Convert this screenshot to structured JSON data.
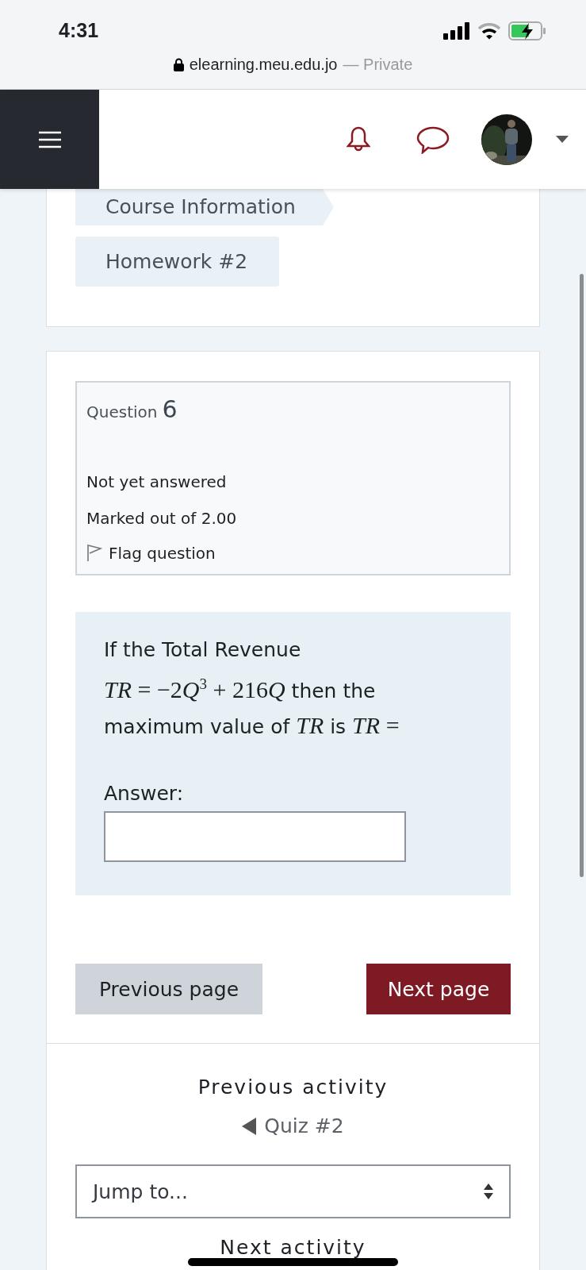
{
  "status_bar": {
    "time": "4:31"
  },
  "address_bar": {
    "url": "elearning.meu.edu.jo",
    "mode": "— Private"
  },
  "breadcrumb": [
    {
      "label": "Course Information",
      "kind": "chevron"
    },
    {
      "label": "Homework #2",
      "kind": "plain"
    }
  ],
  "question_info": {
    "label": "Question",
    "number": "6",
    "status": "Not yet answered",
    "marks": "Marked out of 2.00",
    "flag": "Flag question",
    "flagged": false
  },
  "question": {
    "segments": [
      {
        "kind": "text",
        "text": "If the Total Revenue"
      },
      {
        "kind": "math",
        "tokens": [
          {
            "kind": "var",
            "text": "TR"
          },
          {
            "kind": "op",
            "text": " = −2"
          },
          {
            "kind": "var",
            "text": "Q"
          },
          {
            "kind": "sup",
            "text": "3"
          },
          {
            "kind": "op",
            "text": " + 216"
          },
          {
            "kind": "var",
            "text": "Q"
          }
        ]
      },
      {
        "kind": "text",
        "text": "then the maximum value of"
      },
      {
        "kind": "math",
        "tokens": [
          {
            "kind": "var",
            "text": "TR"
          }
        ]
      },
      {
        "kind": "text",
        "text": "is"
      },
      {
        "kind": "math",
        "tokens": [
          {
            "kind": "var",
            "text": "TR"
          },
          {
            "kind": "op",
            "text": " ="
          }
        ]
      }
    ],
    "answer_label": "Answer:"
  },
  "buttons": [
    {
      "label": "Previous page",
      "kind": "secondary"
    },
    {
      "label": "Next page",
      "kind": "primary"
    }
  ],
  "activity_nav": {
    "previous_heading": "Previous activity",
    "previous_link": "Quiz #2",
    "jump_placeholder": "Jump to...",
    "next_heading": "Next activity"
  }
}
